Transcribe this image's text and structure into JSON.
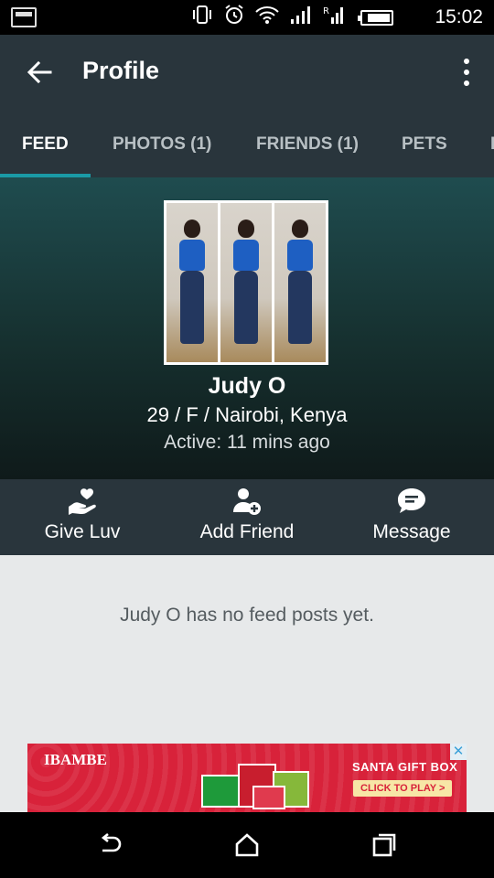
{
  "status_bar": {
    "time": "15:02",
    "icons": [
      "screenshot-icon",
      "vibrate-icon",
      "alarm-icon",
      "wifi-icon",
      "signal-icon",
      "roaming-signal-icon",
      "battery-icon"
    ],
    "roaming_label": "R"
  },
  "app_bar": {
    "title": "Profile",
    "back_icon": "arrow-left-icon",
    "menu_icon": "more-vert-icon"
  },
  "tabs": [
    {
      "label": "FEED",
      "active": true
    },
    {
      "label": "PHOTOS (1)",
      "active": false
    },
    {
      "label": "FRIENDS (1)",
      "active": false
    },
    {
      "label": "PETS",
      "active": false
    }
  ],
  "profile": {
    "name": "Judy O",
    "details": "29 / F / Nairobi, Kenya",
    "active": "Active: 11 mins ago"
  },
  "actions": [
    {
      "label": "Give Luv",
      "icon": "heart-hand-icon"
    },
    {
      "label": "Add Friend",
      "icon": "add-person-icon"
    },
    {
      "label": "Message",
      "icon": "chat-bubble-icon"
    }
  ],
  "feed": {
    "empty_message": "Judy O has no feed posts yet."
  },
  "ad": {
    "brand": "IBAMBE",
    "title": "SANTA GIFT BOX",
    "cta": "CLICK TO PLAY >",
    "close": "✕"
  },
  "colors": {
    "app_bar": "#29353c",
    "accent": "#1a9aa6",
    "ad_red": "#d8223a",
    "feed_bg": "#e7e9ea"
  }
}
